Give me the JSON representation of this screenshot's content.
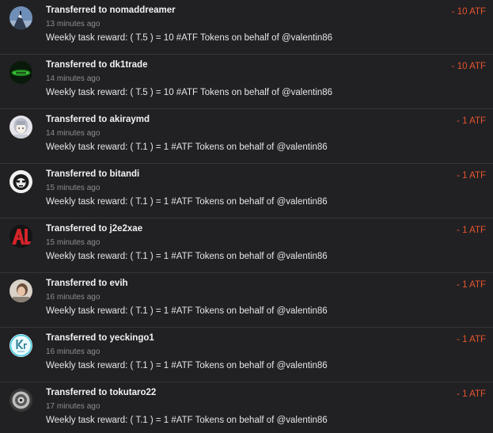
{
  "transfers": [
    {
      "title": "Transferred to nomaddreamer",
      "time": "13 minutes ago",
      "memo": "Weekly task reward: ( T.5 ) = 10 #ATF Tokens on behalf of @valentin86",
      "amount": "- 10 ATF",
      "avatar_icon": "mountain-climber-avatar"
    },
    {
      "title": "Transferred to dk1trade",
      "time": "14 minutes ago",
      "memo": "Weekly task reward: ( T.5 ) = 10 #ATF Tokens on behalf of @valentin86",
      "amount": "- 10 ATF",
      "avatar_icon": "green-logo-avatar"
    },
    {
      "title": "Transferred to akiraymd",
      "time": "14 minutes ago",
      "memo": "Weekly task reward: ( T.1 ) = 1 #ATF Tokens on behalf of @valentin86",
      "amount": "- 1 ATF",
      "avatar_icon": "anime-girl-avatar"
    },
    {
      "title": "Transferred to bitandi",
      "time": "15 minutes ago",
      "memo": "Weekly task reward: ( T.1 ) = 1 #ATF Tokens on behalf of @valentin86",
      "amount": "- 1 ATF",
      "avatar_icon": "bw-face-avatar"
    },
    {
      "title": "Transferred to j2e2xae",
      "time": "15 minutes ago",
      "memo": "Weekly task reward: ( T.1 ) = 1 #ATF Tokens on behalf of @valentin86",
      "amount": "- 1 ATF",
      "avatar_icon": "red-letters-avatar"
    },
    {
      "title": "Transferred to evih",
      "time": "16 minutes ago",
      "memo": "Weekly task reward: ( T.1 ) = 1 #ATF Tokens on behalf of @valentin86",
      "amount": "- 1 ATF",
      "avatar_icon": "photo-avatar"
    },
    {
      "title": "Transferred to yeckingo1",
      "time": "16 minutes ago",
      "memo": "Weekly task reward: ( T.1 ) = 1 #ATF Tokens on behalf of @valentin86",
      "amount": "- 1 ATF",
      "avatar_icon": "krypton-element-avatar"
    },
    {
      "title": "Transferred to tokutaro22",
      "time": "17 minutes ago",
      "memo": "Weekly task reward: ( T.1 ) = 1 #ATF Tokens on behalf of @valentin86",
      "amount": "- 1 ATF",
      "avatar_icon": "grey-pattern-avatar"
    }
  ],
  "colors": {
    "background": "#212124",
    "divider": "#34343a",
    "title_text": "#f2f2f2",
    "time_text": "#8d8d93",
    "amount_text": "#e8542c"
  }
}
